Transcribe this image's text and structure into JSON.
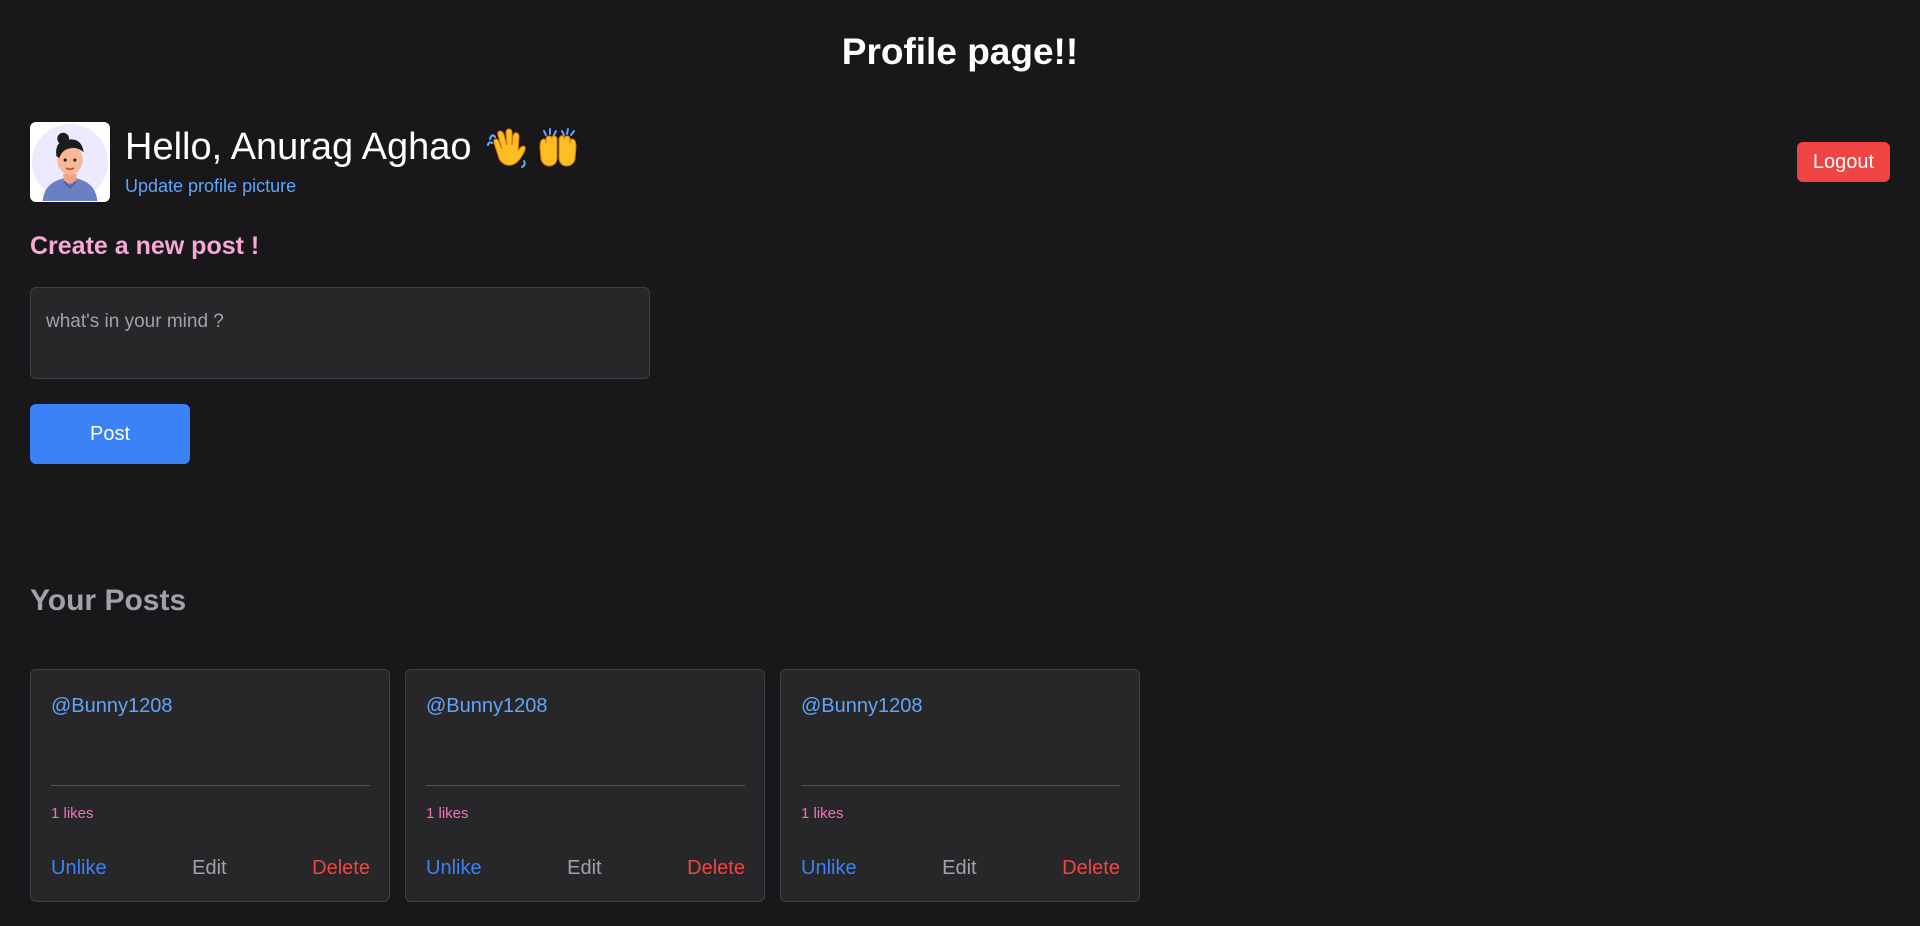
{
  "page": {
    "title": "Profile page!!"
  },
  "profile": {
    "greeting": "Hello, Anurag Aghao",
    "update_link": "Update profile picture",
    "emojis": [
      "waving-hand-icon",
      "raising-hands-icon"
    ]
  },
  "header": {
    "logout_label": "Logout"
  },
  "create_post": {
    "heading": "Create a new post !",
    "placeholder": "what's in your mind ?",
    "value": "",
    "button_label": "Post"
  },
  "posts": {
    "heading": "Your Posts",
    "items": [
      {
        "username": "@Bunny1208",
        "content": "",
        "likes": "1 likes",
        "like_action": "Unlike",
        "edit_action": "Edit",
        "delete_action": "Delete"
      },
      {
        "username": "@Bunny1208",
        "content": "",
        "likes": "1 likes",
        "like_action": "Unlike",
        "edit_action": "Edit",
        "delete_action": "Delete"
      },
      {
        "username": "@Bunny1208",
        "content": "",
        "likes": "1 likes",
        "like_action": "Unlike",
        "edit_action": "Edit",
        "delete_action": "Delete"
      }
    ]
  },
  "colors": {
    "background": "#18181b",
    "card": "#27272a",
    "accent_blue": "#3b82f6",
    "link_blue": "#60a5fa",
    "danger_red": "#ef4444",
    "pink_heading": "#f9a8d4",
    "likes_pink": "#f472b6",
    "muted_gray": "#a1a1aa"
  }
}
